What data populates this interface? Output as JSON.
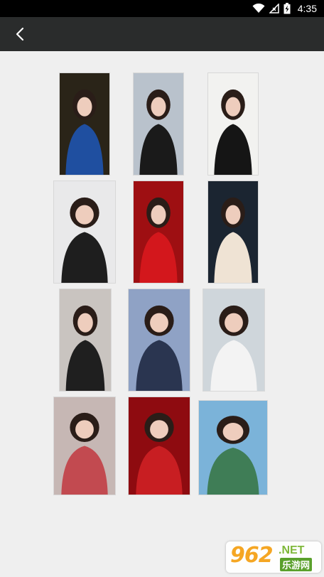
{
  "status_bar": {
    "time": "4:35"
  },
  "header": {
    "back_icon": "chevron-left-icon"
  },
  "gallery": {
    "items": [
      {
        "name": "photo-1",
        "bg": "#2a2418",
        "accent": "#1f4fa0"
      },
      {
        "name": "photo-2",
        "bg": "#b9c2cc",
        "accent": "#1a1a1a"
      },
      {
        "name": "photo-3",
        "bg": "#f2f2f0",
        "accent": "#151515"
      },
      {
        "name": "photo-4",
        "bg": "#e9e9ea",
        "accent": "#1e1e1e"
      },
      {
        "name": "photo-5",
        "bg": "#9e0f12",
        "accent": "#d3171c"
      },
      {
        "name": "photo-6",
        "bg": "#1b2531",
        "accent": "#efe3d4"
      },
      {
        "name": "photo-7",
        "bg": "#c9c4c0",
        "accent": "#1f1f1f"
      },
      {
        "name": "photo-8",
        "bg": "#8fa2c5",
        "accent": "#2a3550"
      },
      {
        "name": "photo-9",
        "bg": "#cfd6db",
        "accent": "#f3f3f3"
      },
      {
        "name": "photo-10",
        "bg": "#c6b7b4",
        "accent": "#c24a50"
      },
      {
        "name": "photo-11",
        "bg": "#8e0b10",
        "accent": "#c81e22"
      },
      {
        "name": "photo-12",
        "bg": "#7bb3d9",
        "accent": "#3f7d56"
      }
    ]
  },
  "watermark": {
    "number": "962",
    "domain": ".NET",
    "cn": "乐游网"
  }
}
